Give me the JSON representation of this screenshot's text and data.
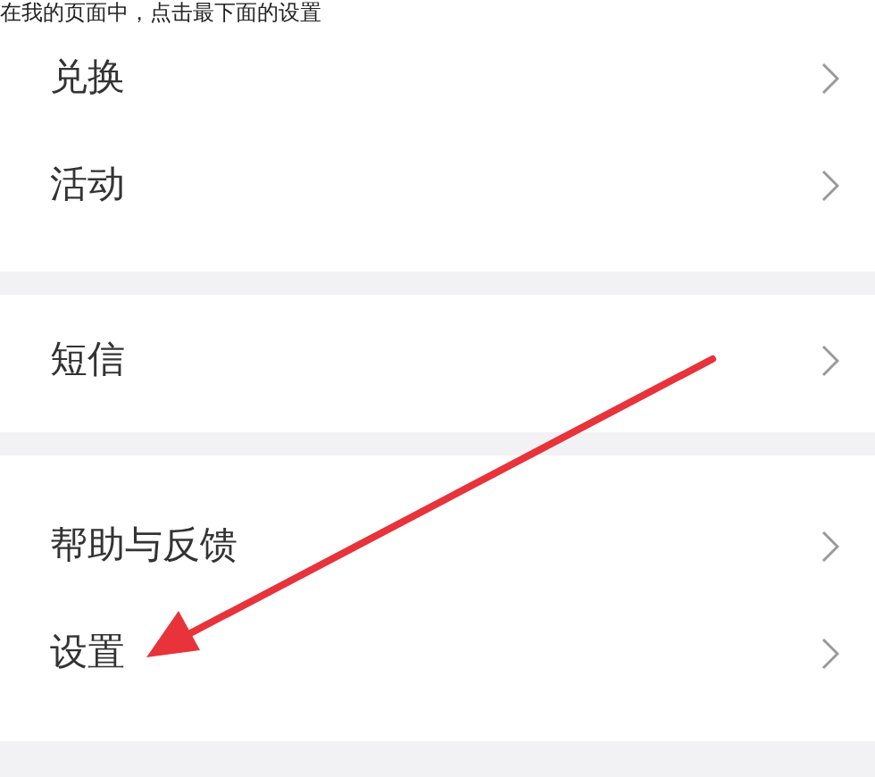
{
  "caption": "在我的页面中，点击最下面的设置",
  "sections": [
    {
      "items": [
        {
          "label": "兑换"
        },
        {
          "label": "活动"
        }
      ]
    },
    {
      "items": [
        {
          "label": "短信"
        }
      ]
    },
    {
      "items": [
        {
          "label": "帮助与反馈"
        },
        {
          "label": "设置"
        }
      ]
    }
  ]
}
